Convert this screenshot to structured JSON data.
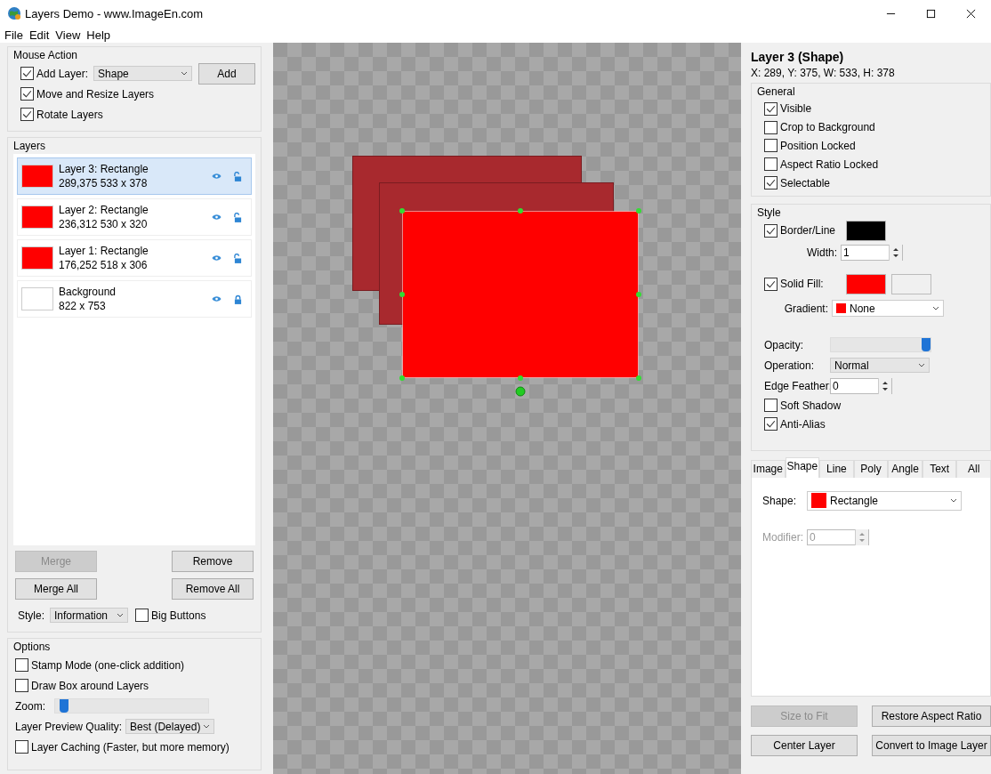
{
  "window": {
    "title": "Layers Demo  - www.ImageEn.com"
  },
  "menu": [
    "File",
    "Edit",
    "View",
    "Help"
  ],
  "mouse_action": {
    "title": "Mouse Action",
    "add_layer": {
      "label": "Add Layer:",
      "checked": true,
      "value": "Shape"
    },
    "add_button": "Add",
    "options": [
      {
        "label": "Move and Resize Layers",
        "checked": true
      },
      {
        "label": "Rotate Layers",
        "checked": true
      }
    ]
  },
  "layers_panel": {
    "title": "Layers",
    "layers": [
      {
        "name": "Layer 3: Rectangle",
        "info": "289,375  533 x 378",
        "selected": true,
        "color": "#ff0000",
        "locked": false
      },
      {
        "name": "Layer 2: Rectangle",
        "info": "236,312  530 x 320",
        "selected": false,
        "color": "#ff0000",
        "locked": false
      },
      {
        "name": "Layer 1: Rectangle",
        "info": "176,252  518 x 306",
        "selected": false,
        "color": "#ff0000",
        "locked": false
      },
      {
        "name": "Background",
        "info": "822 x 753",
        "selected": false,
        "color": "#ffffff",
        "locked": true
      }
    ],
    "buttons": [
      {
        "label": "Merge",
        "disabled": true
      },
      {
        "label": "Remove",
        "disabled": false
      },
      {
        "label": "Merge All",
        "disabled": false
      },
      {
        "label": "Remove All",
        "disabled": false
      }
    ],
    "style": {
      "label": "Style:",
      "value": "Information"
    },
    "big_buttons": {
      "label": "Big Buttons",
      "checked": false
    }
  },
  "options": {
    "title": "Options",
    "checks": [
      {
        "label": "Stamp Mode (one-click addition)",
        "checked": false
      },
      {
        "label": "Draw Box around Layers",
        "checked": false
      }
    ],
    "zoom": {
      "label": "Zoom:",
      "level": 0.03
    },
    "preview_quality": {
      "label": "Layer Preview Quality:",
      "value": "Best (Delayed)"
    },
    "caching": {
      "label": "Layer Caching (Faster, but more memory)",
      "checked": false
    }
  },
  "properties": {
    "title": "Layer 3 (Shape)",
    "coords": "X: 289, Y: 375, W: 533, H: 378",
    "general": {
      "title": "General",
      "items": [
        {
          "label": "Visible",
          "checked": true
        },
        {
          "label": "Crop to Background",
          "checked": false
        },
        {
          "label": "Position Locked",
          "checked": false
        },
        {
          "label": "Aspect Ratio Locked",
          "checked": false
        },
        {
          "label": "Selectable",
          "checked": true
        }
      ]
    },
    "style": {
      "title": "Style",
      "border": {
        "label": "Border/Line",
        "checked": true,
        "color": "#000000"
      },
      "width": {
        "label": "Width:",
        "value": "1"
      },
      "fill": {
        "label": "Solid Fill:",
        "checked": true,
        "swatches": [
          {
            "color": "#ff0000"
          },
          {
            "color": "#f0f0f0"
          }
        ]
      },
      "gradient": {
        "label": "Gradient:",
        "value": "None",
        "color": "#ff0000"
      },
      "opacity": {
        "label": "Opacity:",
        "level": 1.0
      },
      "operation": {
        "label": "Operation:",
        "value": "Normal"
      },
      "edge_feather": {
        "label": "Edge Feather:",
        "value": "0"
      },
      "soft_shadow": {
        "label": "Soft Shadow",
        "checked": false
      },
      "anti_alias": {
        "label": "Anti-Alias",
        "checked": true
      }
    }
  },
  "tabs": [
    {
      "label": "Image",
      "selected": false
    },
    {
      "label": "Shape",
      "selected": true
    },
    {
      "label": "Line",
      "selected": false
    },
    {
      "label": "Poly",
      "selected": false
    },
    {
      "label": "Angle",
      "selected": false
    },
    {
      "label": "Text",
      "selected": false
    },
    {
      "label": "All",
      "selected": false
    }
  ],
  "shape_tab": {
    "shape": {
      "label": "Shape:",
      "value": "Rectangle",
      "color": "#ff0000"
    },
    "modifier": {
      "label": "Modifier:",
      "value": "0",
      "disabled": true
    }
  },
  "buttons": [
    {
      "label": "Size to Fit",
      "disabled": true
    },
    {
      "label": "Restore Aspect Ratio",
      "disabled": false
    },
    {
      "label": "Center Layer",
      "disabled": false
    },
    {
      "label": "Convert to Image Layer",
      "disabled": false
    }
  ]
}
